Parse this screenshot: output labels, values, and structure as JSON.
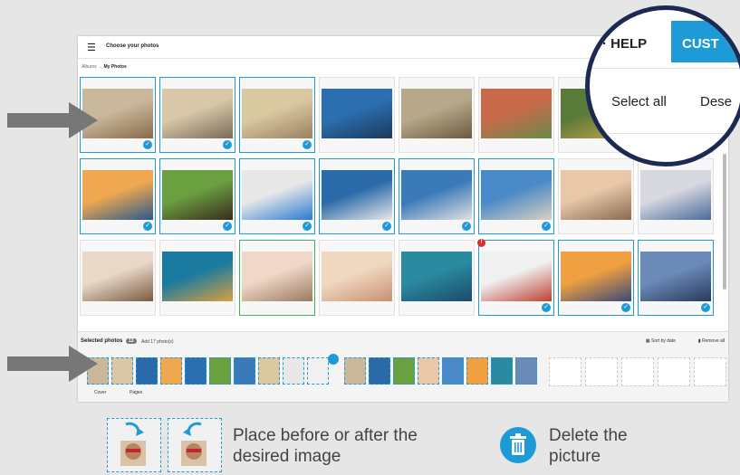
{
  "app": {
    "title": "Choose your photos",
    "menu_icon": "hamburger-icon"
  },
  "breadcrumb": {
    "root": "Albums",
    "separator": "→",
    "current": "My Photos"
  },
  "grid": {
    "rows": 3,
    "columns": 8,
    "items": [
      {
        "selected": true
      },
      {
        "selected": true
      },
      {
        "selected": true
      },
      {
        "selected": false
      },
      {
        "selected": false
      },
      {
        "selected": false
      },
      {
        "selected": false
      },
      {
        "selected": false
      },
      {
        "selected": true
      },
      {
        "selected": true
      },
      {
        "selected": true
      },
      {
        "selected": true
      },
      {
        "selected": true
      },
      {
        "selected": true
      },
      {
        "selected": false
      },
      {
        "selected": false
      },
      {
        "selected": false
      },
      {
        "selected": false
      },
      {
        "selected": false
      },
      {
        "selected": false
      },
      {
        "selected": false
      },
      {
        "selected": true,
        "warning": true
      },
      {
        "selected": true
      },
      {
        "selected": true
      }
    ],
    "warning_symbol": "!",
    "check_symbol": "✓"
  },
  "selected_bar": {
    "label": "Selected photos",
    "count": "13",
    "add_text": "Add 17 photo(s)",
    "sort_label": "Sort by date",
    "remove_label": "Remove all"
  },
  "tabs": {
    "cover": "Cover",
    "pages": "Pages"
  },
  "zoom_panel": {
    "help": "HELP",
    "help_prefix": "·",
    "custom": "CUST",
    "select_all": "Select all",
    "deselect": "Dese"
  },
  "legend": {
    "move_text_line1": "Place before or after the",
    "move_text_line2": "desired image",
    "delete_line1": "Delete the",
    "delete_line2": "picture"
  },
  "colors": {
    "accent": "#1e9bd7",
    "ring": "#1c2a52",
    "arrow": "#777777",
    "warning": "#d9302f",
    "green": "#3cb05a"
  }
}
